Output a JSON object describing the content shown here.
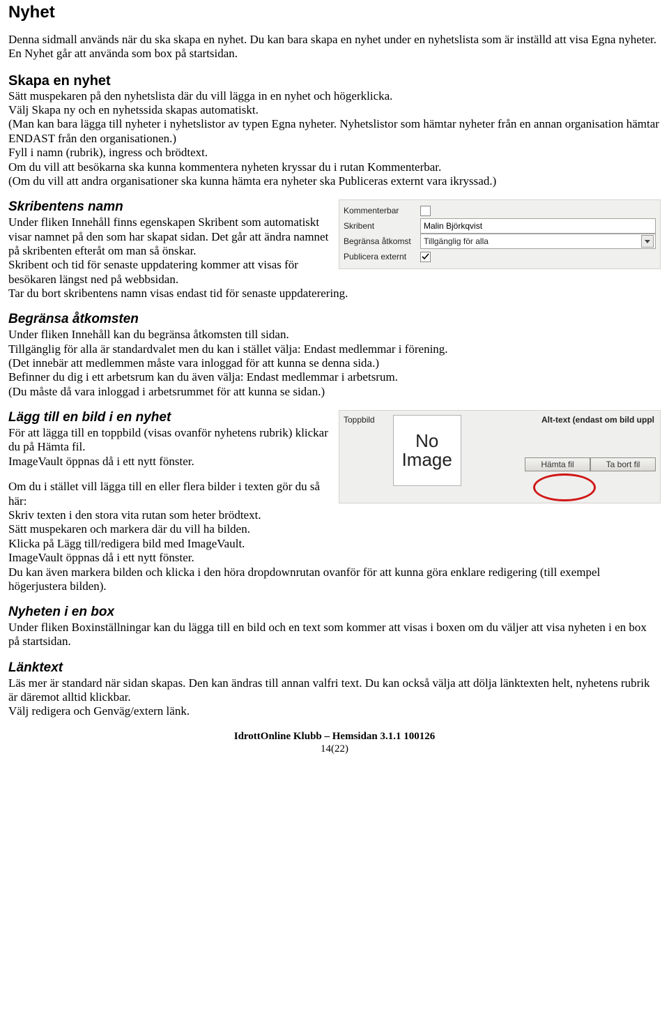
{
  "h_nyhet": "Nyhet",
  "intro_p": "Denna sidmall används när du ska skapa en nyhet. Du kan bara skapa en nyhet under en nyhetslista som är inställd att visa Egna nyheter. En Nyhet går att använda som box på startsidan.",
  "h_skapa": "Skapa en nyhet",
  "skapa_l1": "Sätt muspekaren på den nyhetslista där du vill lägga in en nyhet och högerklicka.",
  "skapa_l2": "Välj Skapa ny och en nyhetssida skapas automatiskt.",
  "skapa_l3": "(Man kan bara lägga till nyheter i nyhetslistor av typen Egna nyheter. Nyhetslistor som hämtar nyheter från en annan organisation hämtar ENDAST från den organisationen.)",
  "skapa_l4": "Fyll i namn (rubrik), ingress och brödtext.",
  "skapa_l5": "Om du vill att besökarna ska kunna kommentera nyheten kryssar du i rutan Kommenterbar.",
  "skapa_l6": "(Om du vill att andra organisationer ska kunna hämta era nyheter ska Publiceras externt vara ikryssad.)",
  "h_skribent": "Skribentens namn",
  "skribent_l1": "Under fliken Innehåll finns egenskapen Skribent som automatiskt visar namnet på den som har skapat sidan. Det går att ändra namnet på skribenten efteråt om man så önskar.",
  "skribent_l2": "Skribent och tid för senaste uppdatering kommer att visas för besökaren längst ned på webbsidan.",
  "skribent_l3": "Tar du bort skribentens namn visas endast tid för senaste uppdaterering.",
  "panel": {
    "kommenterbar_label": "Kommenterbar",
    "skribent_label": "Skribent",
    "skribent_value": "Malin Björkqvist",
    "begransa_label": "Begränsa åtkomst",
    "begransa_value": "Tillgänglig för alla",
    "publicera_label": "Publicera externt"
  },
  "h_begransa": "Begränsa åtkomsten",
  "begr_l1": "Under fliken Innehåll kan du begränsa åtkomsten till sidan.",
  "begr_l2": "Tillgänglig för alla är standardvalet men du kan i stället välja: Endast medlemmar i förening.",
  "begr_l3": "(Det innebär att medlemmen måste vara inloggad för att kunna se denna sida.)",
  "begr_l4": "Befinner du dig i ett arbetsrum kan du även välja: Endast medlemmar i arbetsrum.",
  "begr_l5": "(Du måste då vara inloggad i arbetsrummet för att kunna se sidan.)",
  "h_laggbild": "Lägg till en bild i en nyhet",
  "lb_l1": "För att lägga till en toppbild (visas ovanför nyhetens rubrik) klickar du på Hämta fil.",
  "lb_l2": "ImageVault öppnas då i ett nytt fönster.",
  "lb_l3": "Om du i stället vill lägga till en eller flera bilder i texten gör du så här:",
  "lb_l4": "Skriv texten i den stora vita rutan som heter brödtext.",
  "lb_l5": "Sätt muspekaren och markera där du vill ha bilden.",
  "lb_l6": "Klicka på Lägg till/redigera bild med ImageVault.",
  "lb_l7": "ImageVault öppnas då i ett nytt fönster.",
  "lb_l8": "Du kan även markera bilden och klicka i den höra dropdownrutan ovanför för att kunna göra enklare redigering (till exempel högerjustera bilden).",
  "toppbild": {
    "label": "Toppbild",
    "noimage_1": "No",
    "noimage_2": "Image",
    "alt_label": "Alt-text (endast om bild uppl",
    "hamta": "Hämta fil",
    "tabort": "Ta bort fil"
  },
  "h_box": "Nyheten i en box",
  "box_p": "Under fliken Boxinställningar kan du lägga till en bild och en text som kommer att visas i boxen om du väljer att visa nyheten i en box på startsidan.",
  "h_lank": "Länktext",
  "lank_l1": "Läs mer är standard när sidan skapas. Den kan ändras till annan valfri text. Du kan också välja att dölja länktexten helt, nyhetens rubrik är däremot alltid klickbar.",
  "lank_l2": "Välj redigera och Genväg/extern länk.",
  "footer_title": "IdrottOnline Klubb – Hemsidan 3.1.1 100126",
  "footer_page": "14(22)"
}
